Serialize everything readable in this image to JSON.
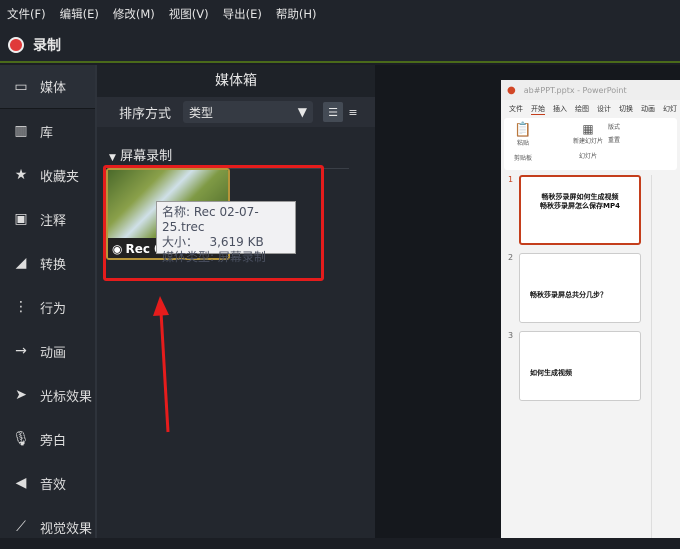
{
  "menu": [
    "文件(F)",
    "编辑(E)",
    "修改(M)",
    "视图(V)",
    "导出(E)",
    "帮助(H)"
  ],
  "record_label": "录制",
  "sidebar": [
    {
      "icon": "film-icon",
      "glyph": "▭",
      "label": "媒体"
    },
    {
      "icon": "library-icon",
      "glyph": "▥",
      "label": "库"
    },
    {
      "icon": "star-icon",
      "glyph": "★",
      "label": "收藏夹"
    },
    {
      "icon": "annotation-icon",
      "glyph": "▣",
      "label": "注释"
    },
    {
      "icon": "transition-icon",
      "glyph": "◢",
      "label": "转换"
    },
    {
      "icon": "behavior-icon",
      "glyph": "⋮",
      "label": "行为"
    },
    {
      "icon": "animation-icon",
      "glyph": "→",
      "label": "动画"
    },
    {
      "icon": "cursor-icon",
      "glyph": "➤",
      "label": "光标效果"
    },
    {
      "icon": "microphone-icon",
      "glyph": "🎙",
      "label": "旁白"
    },
    {
      "icon": "speaker-icon",
      "glyph": "◀",
      "label": "音效"
    },
    {
      "icon": "wand-icon",
      "glyph": "⟋",
      "label": "视觉效果"
    }
  ],
  "panel": {
    "title": "媒体箱",
    "sort_label": "排序方式",
    "sort_value": "类型",
    "group": "屏幕录制"
  },
  "clip": {
    "label": "Rec 02-07-25.trec",
    "tooltip": {
      "name": "名称: Rec 02-07-25.trec",
      "size": "大小：   3,619 KB",
      "type": "媒体类型: 屏幕录制"
    }
  },
  "ppt": {
    "filename": "ab#PPT.pptx - PowerPoint",
    "tabs": [
      "文件",
      "开始",
      "插入",
      "绘图",
      "设计",
      "切换",
      "动画",
      "幻灯"
    ],
    "ribbon": {
      "paste": "粘贴",
      "clipboard": "剪贴板",
      "new_slide": "新建幻灯片",
      "slides": "幻灯片",
      "layout": "版式",
      "reset": "重置"
    },
    "slides": [
      {
        "num": "1",
        "title": "畅秋莎录屏如何生成视频\n畅秋莎录屏怎么保存MP4"
      },
      {
        "num": "2",
        "title": "畅秋莎录屏总共分几步？"
      },
      {
        "num": "3",
        "title": "如何生成视频"
      }
    ]
  }
}
